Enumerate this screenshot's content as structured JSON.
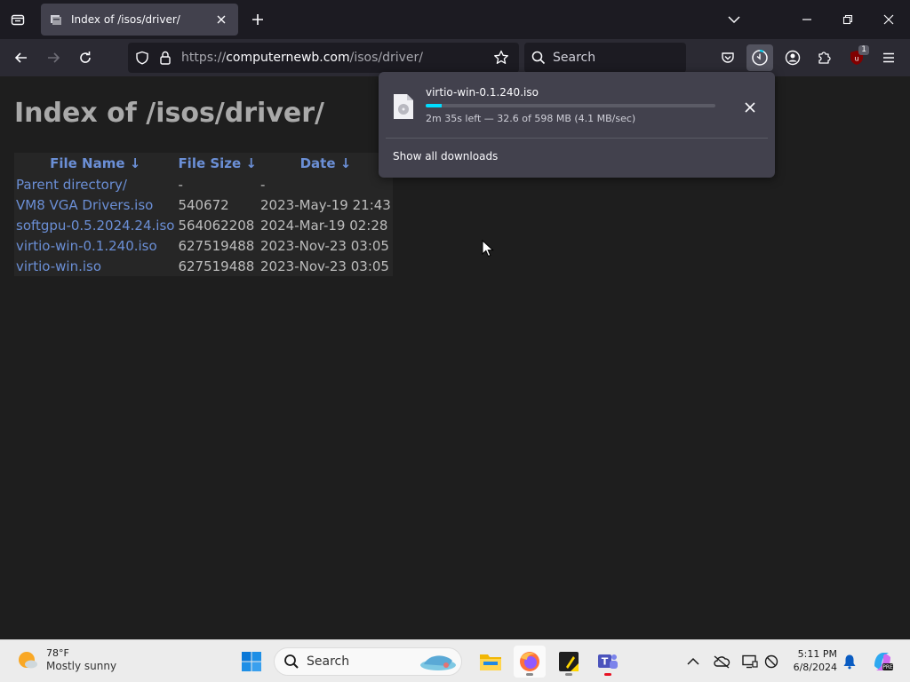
{
  "browser": {
    "tab": {
      "title": "Index of /isos/driver/"
    },
    "url": {
      "scheme": "https://",
      "host": "computernewb.com",
      "path": "/isos/driver/"
    },
    "search": {
      "placeholder": "Search"
    },
    "extension_badge": "1",
    "icons": {
      "tab_list": "tab-list-icon",
      "favicon": "file-favicon",
      "tab_close": "close-icon",
      "new_tab": "plus-icon",
      "back": "arrow-left-icon",
      "forward": "arrow-right-icon",
      "reload": "reload-icon",
      "bookmark": "star-icon",
      "pocket": "pocket-icon",
      "downloads": "downloads-icon",
      "account": "account-icon",
      "extensions": "puzzle-icon",
      "ublock": "ublock-icon",
      "menu": "hamburger-icon"
    }
  },
  "page": {
    "title": "Index of /isos/driver/",
    "columns": [
      "File Name  ↓",
      "File Size  ↓",
      "Date  ↓"
    ],
    "rows": [
      {
        "name": "Parent directory/",
        "size": "-",
        "date": "-",
        "link": false
      },
      {
        "name": "VM8 VGA Drivers.iso",
        "size": "540672",
        "date": "2023-May-19 21:43",
        "link": true
      },
      {
        "name": "softgpu-0.5.2024.24.iso",
        "size": "564062208",
        "date": "2024-Mar-19 02:28",
        "link": true
      },
      {
        "name": "virtio-win-0.1.240.iso",
        "size": "627519488",
        "date": "2023-Nov-23 03:05",
        "link": true
      },
      {
        "name": "virtio-win.iso",
        "size": "627519488",
        "date": "2023-Nov-23 03:05",
        "link": true
      }
    ]
  },
  "downloads_panel": {
    "file_name": "virtio-win-0.1.240.iso",
    "status": "2m 35s left — 32.6 of 598 MB (4.1 MB/sec)",
    "progress_fraction": 0.055,
    "show_all_label": "Show all downloads"
  },
  "taskbar": {
    "weather": {
      "temp": "78°F",
      "condition": "Mostly sunny"
    },
    "search_placeholder": "Search",
    "clock": {
      "time": "5:11 PM",
      "date": "6/8/2024"
    },
    "icons": {
      "weather": "weather-sun-icon",
      "start": "windows-start-icon",
      "search": "search-icon",
      "widget": "search-highlight-icon",
      "explorer": "file-explorer-icon",
      "firefox": "firefox-icon",
      "sticky": "sticky-notes-icon",
      "teams": "teams-icon",
      "chevron": "chevron-up-icon",
      "cloud": "cloud-offline-icon",
      "display": "display-icon",
      "network": "network-icon",
      "bell": "bell-icon",
      "copilot": "copilot-icon"
    }
  },
  "colors": {
    "link": "#6b8fd6",
    "progress": "#00ddff",
    "page_background": "#1e1e1e",
    "panel_background": "#42414d"
  }
}
